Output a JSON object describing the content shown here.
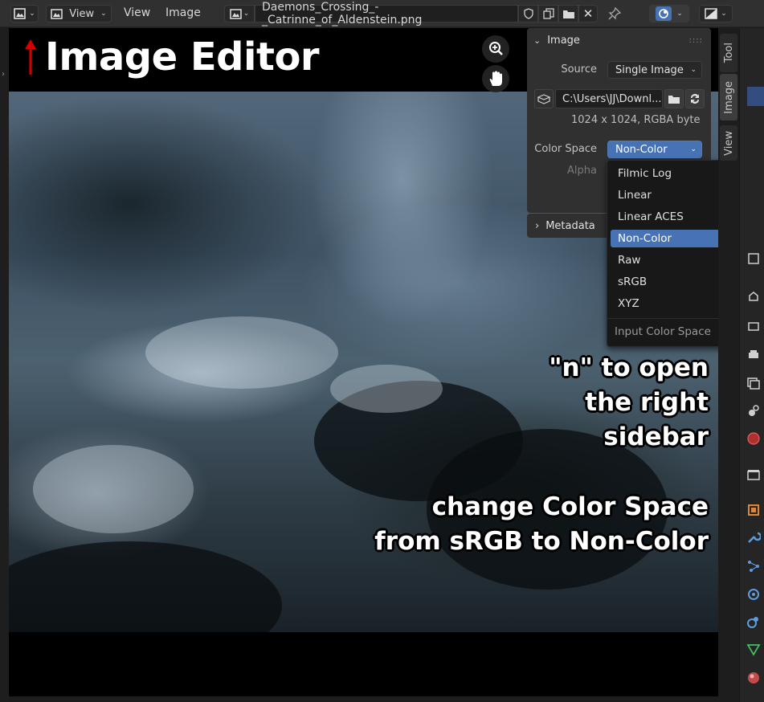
{
  "header": {
    "view_menu_1": "View",
    "view_menu_2": "View",
    "image_menu": "Image",
    "image_name": "Daemons_Crossing_-_Catrinne_of_Aldenstein.png"
  },
  "overlay": {
    "title": "Image Editor",
    "annotation_1": [
      "\"n\" to open",
      "the right",
      "sidebar"
    ],
    "annotation_2": [
      "change Color Space",
      "from sRGB to Non-Color"
    ]
  },
  "panel": {
    "header": "Image",
    "source_label": "Source",
    "source_value": "Single Image",
    "filepath": "C:\\Users\\JJ\\Downl...",
    "info": "1024 x 1024,  RGBA byte",
    "colorspace_label": "Color Space",
    "colorspace_value": "Non-Color",
    "alpha_label": "Alpha",
    "metadata_header": "Metadata"
  },
  "colorspace_menu": {
    "items": [
      "Filmic Log",
      "Linear",
      "Linear ACES",
      "Non-Color",
      "Raw",
      "sRGB",
      "XYZ"
    ],
    "selected": "Non-Color",
    "footer": "Input Color Space"
  },
  "tabs": [
    "Tool",
    "Image",
    "View"
  ],
  "colors": {
    "accent": "#4772b3",
    "header_bg": "#303030",
    "panel_bg": "#303030",
    "arrow": "#d40000"
  }
}
